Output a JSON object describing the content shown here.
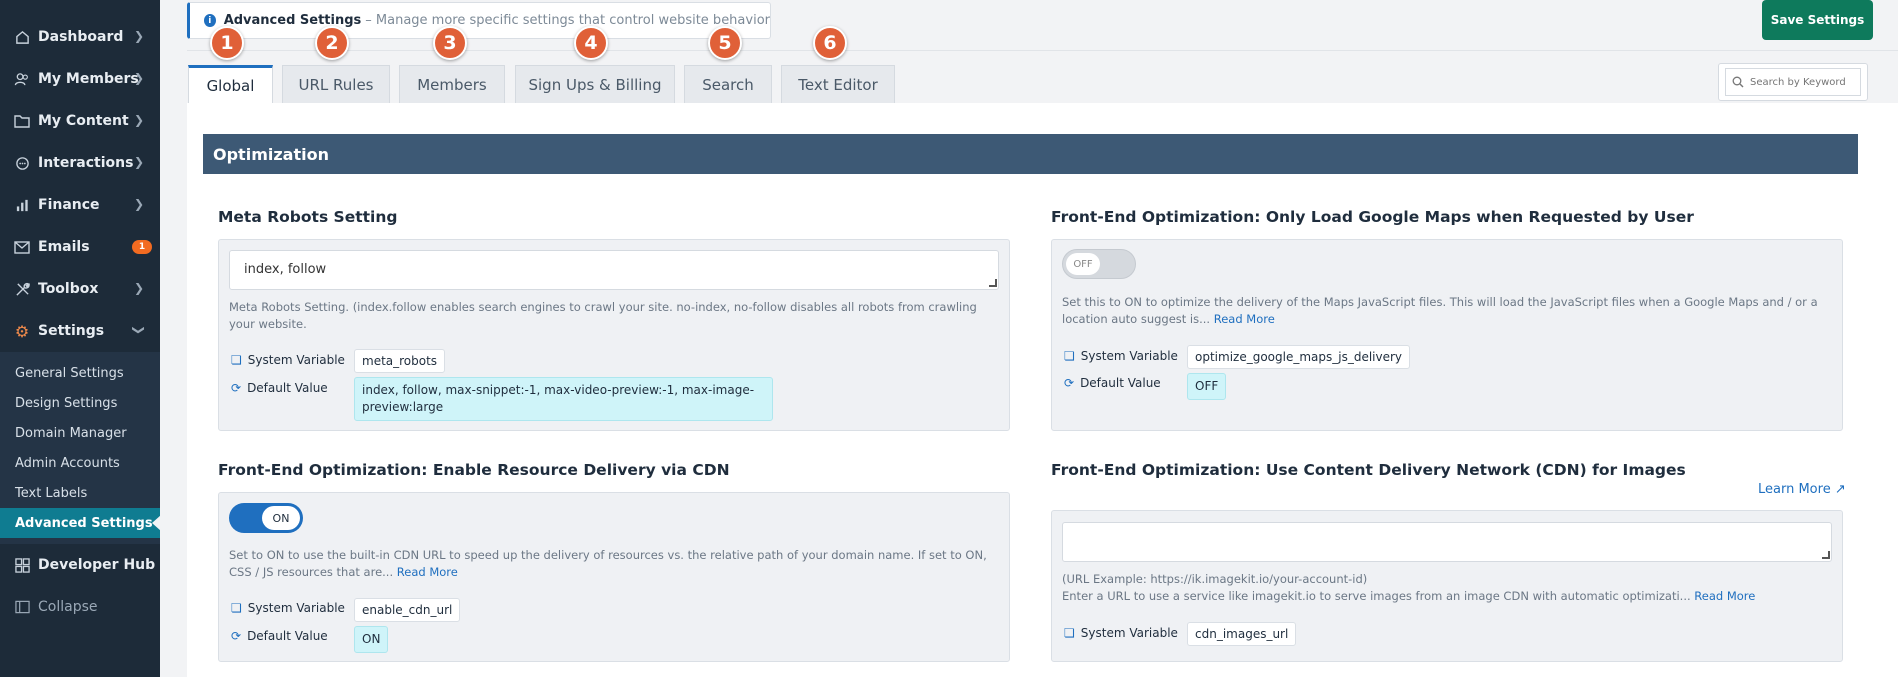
{
  "sidebar": {
    "items": [
      {
        "label": "Dashboard",
        "icon": "home-icon"
      },
      {
        "label": "My Members",
        "icon": "users-icon"
      },
      {
        "label": "My Content",
        "icon": "folder-icon"
      },
      {
        "label": "Interactions",
        "icon": "chat-icon"
      },
      {
        "label": "Finance",
        "icon": "bar-chart-icon"
      },
      {
        "label": "Emails",
        "icon": "mail-icon",
        "badge": "1"
      },
      {
        "label": "Toolbox",
        "icon": "tools-icon"
      },
      {
        "label": "Settings",
        "icon": "gear-icon"
      }
    ],
    "settings_sub": [
      "General Settings",
      "Design Settings",
      "Domain Manager",
      "Admin Accounts",
      "Text Labels",
      "Advanced Settings"
    ],
    "developer_hub": "Developer Hub",
    "collapse": "Collapse"
  },
  "header": {
    "title": "Advanced Settings",
    "description": "– Manage more specific settings that control website behavior"
  },
  "save_label": "Save Settings",
  "steps": [
    "1",
    "2",
    "3",
    "4",
    "5",
    "6"
  ],
  "tabs": [
    "Global",
    "URL Rules",
    "Members",
    "Sign Ups & Billing",
    "Search",
    "Text Editor"
  ],
  "search": {
    "placeholder": "Search by Keyword"
  },
  "section": {
    "title": "Optimization"
  },
  "labels": {
    "system_variable": "System Variable",
    "default_value": "Default Value",
    "read_more": "Read More"
  },
  "settings": {
    "meta_robots": {
      "title": "Meta Robots Setting",
      "value": "index, follow",
      "help": "Meta Robots Setting. (index.follow enables search engines to crawl your site. no-index, no-follow disables all robots from crawling your website.",
      "system_variable": "meta_robots",
      "default_value": "index, follow, max-snippet:-1, max-video-preview:-1, max-image-preview:large"
    },
    "google_maps": {
      "title": "Front-End Optimization: Only Load Google Maps when Requested by User",
      "toggle": "OFF",
      "help": "Set this to ON to optimize the delivery of the Maps JavaScript files. This will load the JavaScript files when a Google Maps and / or a location auto suggest is...",
      "system_variable": "optimize_google_maps_js_delivery",
      "default_value": "OFF"
    },
    "cdn": {
      "title": "Front-End Optimization: Enable Resource Delivery via CDN",
      "toggle": "ON",
      "help": "Set to ON to use the built-in CDN URL to speed up the delivery of resources vs. the relative path of your domain name. If set to ON, CSS / JS resources that are...",
      "system_variable": "enable_cdn_url",
      "default_value": "ON"
    },
    "cdn_images": {
      "title": "Front-End Optimization: Use Content Delivery Network (CDN) for Images",
      "learn_more": "Learn More",
      "value": "",
      "help_example": "(URL Example: https://ik.imagekit.io/your-account-id)",
      "help": "Enter a URL to use a service like imagekit.io to serve images from an image CDN with automatic optimizati...",
      "system_variable": "cdn_images_url"
    }
  },
  "colors": {
    "sidebar": "#1d2b39",
    "active": "#0f7c91",
    "save": "#0e7a5c",
    "section": "#3d5975",
    "step": "#e06038",
    "link": "#1f6fbf"
  }
}
